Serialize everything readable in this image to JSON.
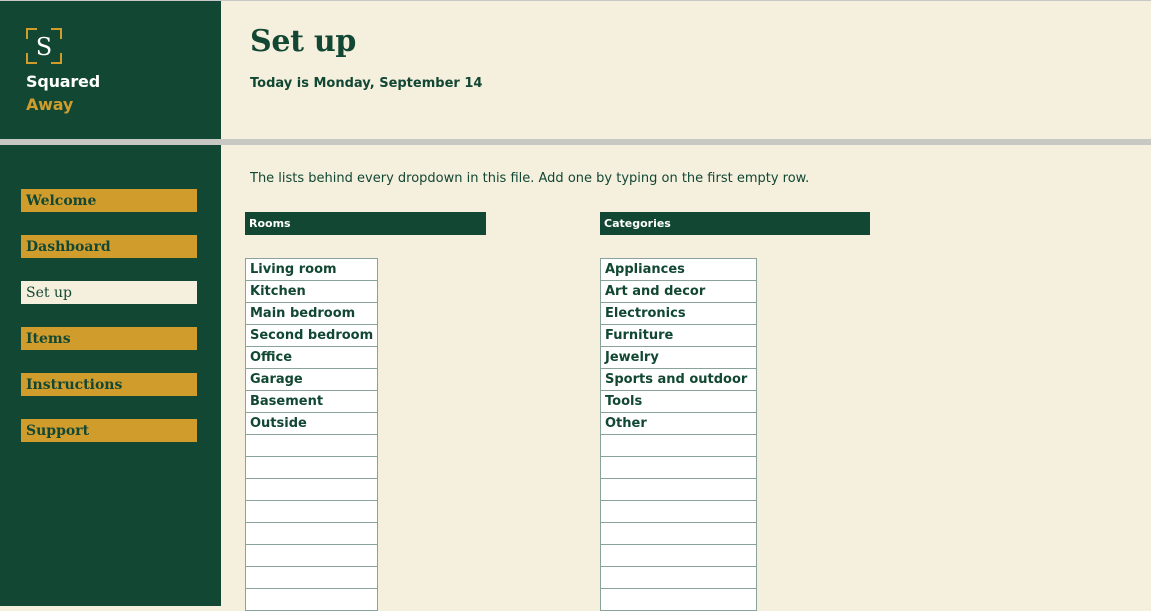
{
  "brand": {
    "logo_letter": "S",
    "name_line1": "Squared",
    "name_line2": "Away"
  },
  "header": {
    "title": "Set up",
    "date": "Today is Monday, September 14"
  },
  "nav": {
    "active": "Set up",
    "items": [
      {
        "label": "Welcome"
      },
      {
        "label": "Dashboard"
      },
      {
        "label": "Set up"
      },
      {
        "label": "Items"
      },
      {
        "label": "Instructions"
      },
      {
        "label": "Support"
      }
    ]
  },
  "intro": "The lists behind every dropdown in this file. Add one by typing on the first empty row.",
  "rooms": {
    "header": "Rooms",
    "items": [
      "Living room",
      "Kitchen",
      "Main bedroom",
      "Second bedroom",
      "Office",
      "Garage",
      "Basement",
      "Outside",
      "",
      "",
      "",
      "",
      "",
      "",
      "",
      ""
    ]
  },
  "categories": {
    "header": "Categories",
    "items": [
      "Appliances",
      "Art and decor",
      "Electronics",
      "Furniture",
      "Jewelry",
      "Sports and outdoor",
      "Tools",
      "Other",
      "",
      "",
      "",
      "",
      "",
      "",
      "",
      ""
    ]
  },
  "colors": {
    "dark_green": "#114733",
    "gold": "#d09d2d",
    "cream": "#f5efdd"
  }
}
